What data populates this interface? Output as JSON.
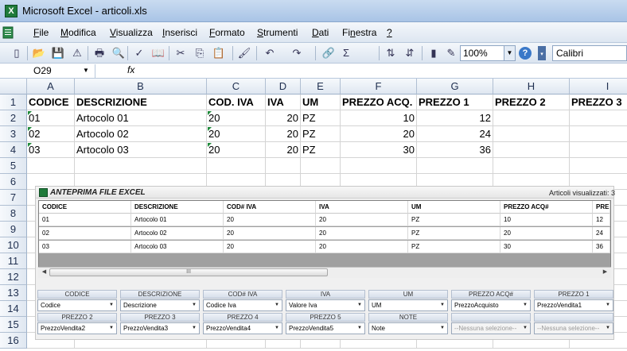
{
  "window": {
    "app_icon": "X",
    "title": "Microsoft Excel - articoli.xls"
  },
  "menu": {
    "items": [
      {
        "key": "F",
        "rest": "ile"
      },
      {
        "key": "M",
        "rest": "odifica"
      },
      {
        "key": "V",
        "rest": "isualizza"
      },
      {
        "key": "I",
        "rest": "nserisci"
      },
      {
        "key": "F",
        "rest": "ormato"
      },
      {
        "key": "S",
        "rest": "trumenti"
      },
      {
        "key": "D",
        "rest": "ati"
      },
      {
        "pre": "Fi",
        "key": "n",
        "rest": "estra"
      },
      {
        "key": "?",
        "rest": ""
      }
    ]
  },
  "toolbar": {
    "icons": [
      "new-icon",
      "open-icon",
      "save-icon",
      "permission-icon",
      "print-icon",
      "print-preview-icon",
      "spelling-icon",
      "research-icon",
      "cut-icon",
      "copy-icon",
      "paste-icon",
      "format-painter-icon",
      "undo-icon",
      "redo-icon",
      "insert-hyperlink-icon",
      "autosum-icon",
      "sort-ascending-icon",
      "sort-descending-icon",
      "chart-wizard-icon",
      "drawing-icon"
    ],
    "zoom": "100%",
    "help": "?",
    "font": "Calibri"
  },
  "formula_bar": {
    "name_box": "O29",
    "fx": "fx",
    "formula": ""
  },
  "sheet": {
    "columns": [
      "A",
      "B",
      "C",
      "D",
      "E",
      "F",
      "G",
      "H",
      "I"
    ],
    "rows": [
      "1",
      "2",
      "3",
      "4",
      "5",
      "6",
      "7",
      "8",
      "9",
      "10",
      "11",
      "12",
      "13",
      "14",
      "15",
      "16"
    ],
    "cells": {
      "r1": [
        "CODICE",
        "DESCRIZIONE",
        "COD. IVA",
        "IVA",
        "UM",
        "PREZZO ACQ.",
        "PREZZO 1",
        "PREZZO 2",
        "PREZZO 3"
      ],
      "r2": [
        "01",
        "Artocolo 01",
        "20",
        "20",
        "PZ",
        "10",
        "12",
        "",
        ""
      ],
      "r3": [
        "02",
        "Artocolo 02",
        "20",
        "20",
        "PZ",
        "20",
        "24",
        "",
        ""
      ],
      "r4": [
        "03",
        "Artocolo 03",
        "20",
        "20",
        "PZ",
        "30",
        "36",
        "",
        ""
      ]
    }
  },
  "preview_panel": {
    "title": "ANTEPRIMA FILE EXCEL",
    "count_label": "Articoli visualizzati: 3",
    "headers": [
      "CODICE",
      "DESCRIZIONE",
      "COD# IVA",
      "IVA",
      "UM",
      "PREZZO ACQ#",
      "PRE"
    ],
    "rows": [
      [
        "01",
        "Artocolo 01",
        "20",
        "20",
        "PZ",
        "10",
        "12"
      ],
      [
        "02",
        "Artocolo 02",
        "20",
        "20",
        "PZ",
        "20",
        "24"
      ],
      [
        "03",
        "Artocolo 03",
        "20",
        "20",
        "PZ",
        "30",
        "36"
      ]
    ],
    "scroll_grip": "III"
  },
  "mapping": {
    "fields": [
      {
        "label": "CODICE",
        "value": "Codice",
        "enabled": true
      },
      {
        "label": "DESCRIZIONE",
        "value": "Descrizione",
        "enabled": true
      },
      {
        "label": "COD# IVA",
        "value": "Codice Iva",
        "enabled": true
      },
      {
        "label": "IVA",
        "value": "Valore Iva",
        "enabled": true
      },
      {
        "label": "UM",
        "value": "UM",
        "enabled": true
      },
      {
        "label": "PREZZO ACQ#",
        "value": "PrezzoAcquisto",
        "enabled": true
      },
      {
        "label": "PREZZO 1",
        "value": "PrezzoVendita1",
        "enabled": true
      },
      {
        "label": "PREZZO 2",
        "value": "PrezzoVendita2",
        "enabled": true
      },
      {
        "label": "PREZZO 3",
        "value": "PrezzoVendita3",
        "enabled": true
      },
      {
        "label": "PREZZO 4",
        "value": "PrezzoVendita4",
        "enabled": true
      },
      {
        "label": "PREZZO 5",
        "value": "PrezzoVendita5",
        "enabled": true
      },
      {
        "label": "NOTE",
        "value": "Note",
        "enabled": true
      },
      {
        "label": "",
        "value": "--Nessuna selezione--",
        "enabled": false
      },
      {
        "label": "",
        "value": "--Nessuna selezione--",
        "enabled": false
      }
    ]
  }
}
